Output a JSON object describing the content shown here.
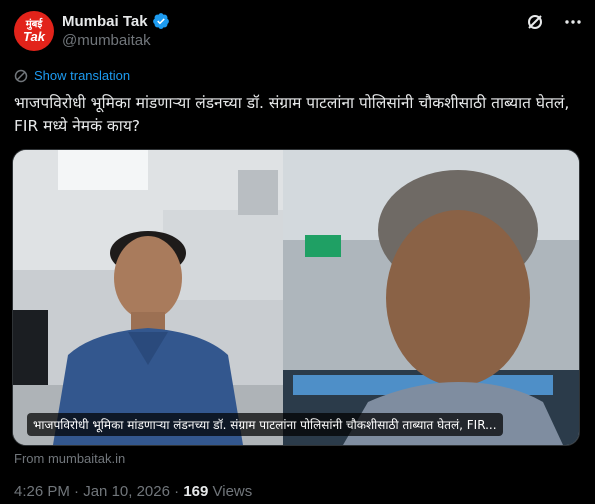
{
  "account": {
    "display_name": "Mumbai Tak",
    "handle": "@mumbaitak",
    "avatar_text_line1": "मुंबई",
    "avatar_text_line2": "Tak",
    "brand_color": "#e2231a",
    "verified_color": "#1d9bf0"
  },
  "top_actions": [
    {
      "icon": "grok-icon"
    },
    {
      "icon": "more-options-icon"
    }
  ],
  "show_translation": {
    "label": "Show translation",
    "icon": "translate-icon"
  },
  "tweet": {
    "text": "भाजपविरोधी भूमिका मांडणाऱ्या लंडनच्या डॉ. संग्राम पाटलांना पोलिसांनी चौकशीसाठी ताब्यात घेतलं, FIR मध्ये नेमकं काय?"
  },
  "media": {
    "caption": "भाजपविरोधी भूमिका मांडणाऱ्या लंडनच्या डॉ. संग्राम पाटलांना पोलिसांनी चौकशीसाठी ताब्यात घेतलं, FIR..."
  },
  "card_source": "From mumbaitak.in",
  "meta": {
    "time": "4:26 PM",
    "separator": "·",
    "date": "Jan 10, 2026",
    "views_count": "169",
    "views_label": "Views"
  }
}
